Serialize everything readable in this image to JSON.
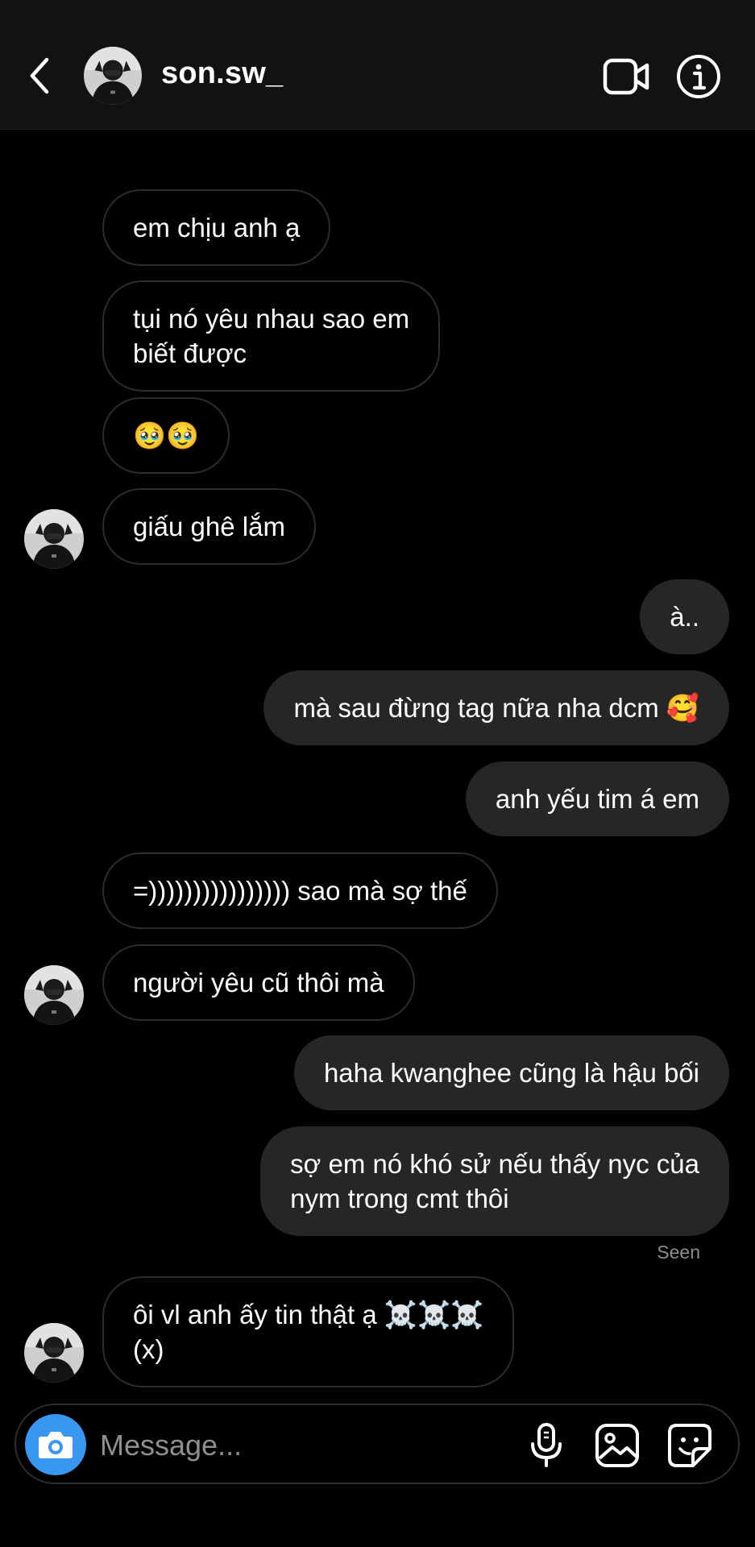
{
  "header": {
    "username": "son.sw_",
    "icons": {
      "back": "chevron-left-icon",
      "video": "video-camera-icon",
      "info": "info-circle-icon"
    }
  },
  "messages": [
    {
      "from": "them",
      "text": "em chịu anh ạ"
    },
    {
      "from": "them",
      "text": "tụi nó yêu nhau sao em\nbiết được"
    },
    {
      "from": "them",
      "text": "🥹🥹"
    },
    {
      "from": "them",
      "text": "giấu ghê lắm",
      "avatar": true
    },
    {
      "from": "me",
      "text": "à.."
    },
    {
      "from": "me",
      "text": "mà sau đừng tag nữa nha dcm 🥰"
    },
    {
      "from": "me",
      "text": "anh yếu tim á em"
    },
    {
      "from": "them",
      "text": "=)))))))))))))))) sao mà sợ thế"
    },
    {
      "from": "them",
      "text": "người yêu cũ thôi mà",
      "avatar": true
    },
    {
      "from": "me",
      "text": "haha kwanghee cũng là hậu bối"
    },
    {
      "from": "me",
      "text": "sợ em nó khó sử nếu thấy nyc của\nnym trong cmt thôi"
    },
    {
      "from": "them",
      "text": "ôi vl anh ấy tin thật ạ ☠️☠️☠️\n(x)",
      "avatar": true
    }
  ],
  "status": {
    "seen": "Seen"
  },
  "composer": {
    "placeholder": "Message...",
    "icons": {
      "camera": "camera-icon",
      "mic": "microphone-icon",
      "gallery": "image-gallery-icon",
      "sticker": "sticker-icon"
    }
  },
  "colors": {
    "background": "#000000",
    "header": "#121212",
    "outgoing_bubble": "#262626",
    "incoming_border": "#2c2c2e",
    "camera_button": "#3897f0",
    "secondary_text": "#8e8e93"
  }
}
